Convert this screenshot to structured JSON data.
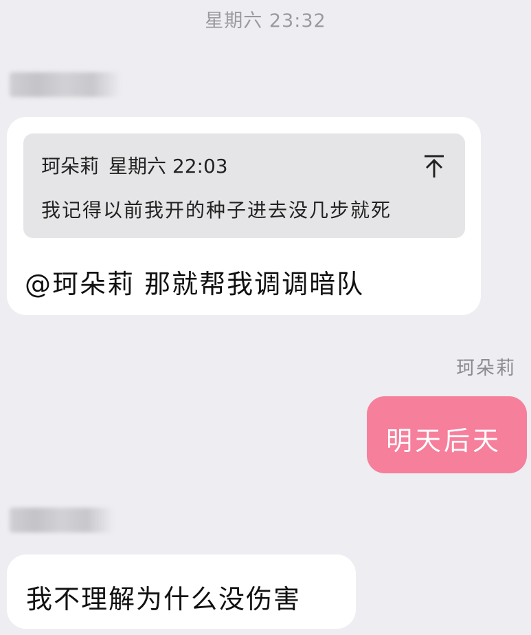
{
  "timestamp": "星期六 23:32",
  "messages": [
    {
      "quote": {
        "author": "珂朵莉",
        "time": "星期六 22:03",
        "text": "我记得以前我开的种子进去没几步就死"
      },
      "text": "@珂朵莉 那就帮我调调暗队"
    },
    {
      "sender": "珂朵莉",
      "text": "明天后天"
    },
    {
      "text": "我不理解为什么没伤害"
    }
  ],
  "icons": {
    "quote_jump": "arrow-up-to-top-icon"
  },
  "colors": {
    "background": "#eeedf1",
    "outgoing_bubble": "#f67f9c",
    "incoming_bubble": "#ffffff",
    "quote_background": "#e5e5e7"
  }
}
